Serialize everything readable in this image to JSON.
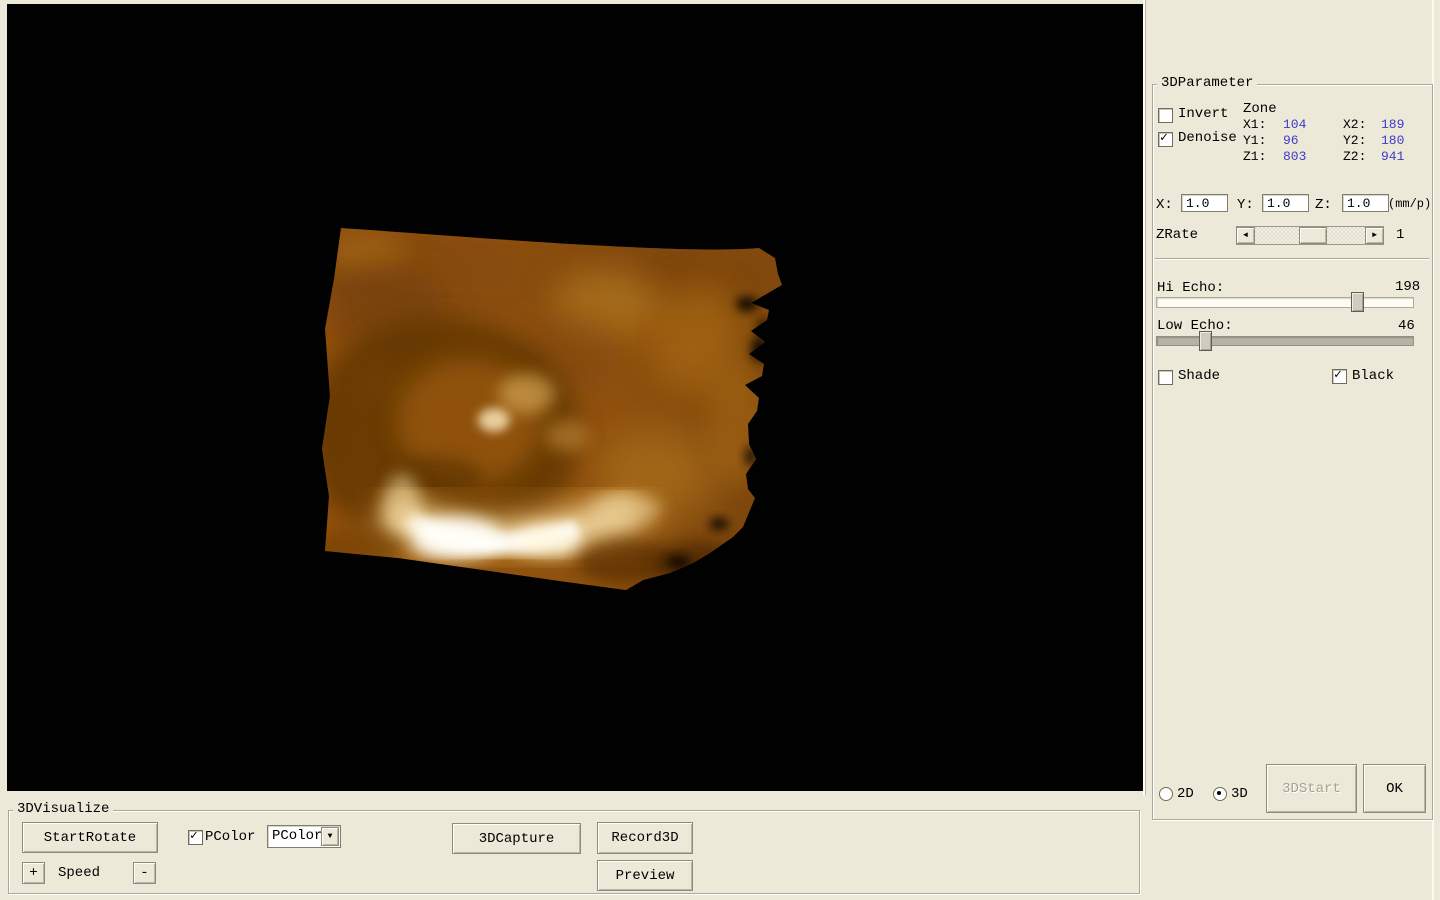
{
  "param_panel": {
    "title": "3DParameter",
    "invert_label": "Invert",
    "denoise_label": "Denoise",
    "zone": {
      "label": "Zone",
      "x1_label": "X1:",
      "x1": "104",
      "x2_label": "X2:",
      "x2": "189",
      "y1_label": "Y1:",
      "y1": "96",
      "y2_label": "Y2:",
      "y2": "180",
      "z1_label": "Z1:",
      "z1": "803",
      "z2_label": "Z2:",
      "z2": "941"
    },
    "scale": {
      "x_label": "X:",
      "x": "1.0",
      "y_label": "Y:",
      "y": "1.0",
      "z_label": "Z:",
      "z": "1.0",
      "unit": "(mm/p)"
    },
    "zrate": {
      "label": "ZRate",
      "value": "1"
    },
    "hi_echo": {
      "label": "Hi Echo:",
      "value": "198"
    },
    "low_echo": {
      "label": "Low Echo:",
      "value": "46"
    },
    "shade_label": "Shade",
    "black_label": "Black",
    "mode_2d_label": "2D",
    "mode_3d_label": "3D",
    "start_button": "3DStart",
    "ok_button": "OK"
  },
  "visualize_panel": {
    "title": "3DVisualize",
    "start_rotate_button": "StartRotate",
    "pcolor_label": "PColor",
    "pcolor_selected": "PColor",
    "capture_button": "3DCapture",
    "record_button": "Record3D",
    "preview_button": "Preview",
    "speed_plus": "+",
    "speed_label": "Speed",
    "speed_minus": "-"
  },
  "states": {
    "invert_checked": false,
    "denoise_checked": true,
    "shade_checked": false,
    "black_checked": true,
    "pcolor_checked": true,
    "mode_2d_selected": false,
    "mode_3d_selected": true,
    "start_disabled": true
  },
  "icons": {
    "dropdown_arrow": "▼",
    "scroll_left_arrow": "◄",
    "scroll_right_arrow": "►"
  },
  "colors": {
    "window_bg": "#ECE9D8",
    "canvas_bg": "#010101",
    "value_text": "#3C3CC8",
    "render_base": "#9A5810",
    "render_dark": "#5F3506",
    "render_bright": "#FFFDF2"
  }
}
